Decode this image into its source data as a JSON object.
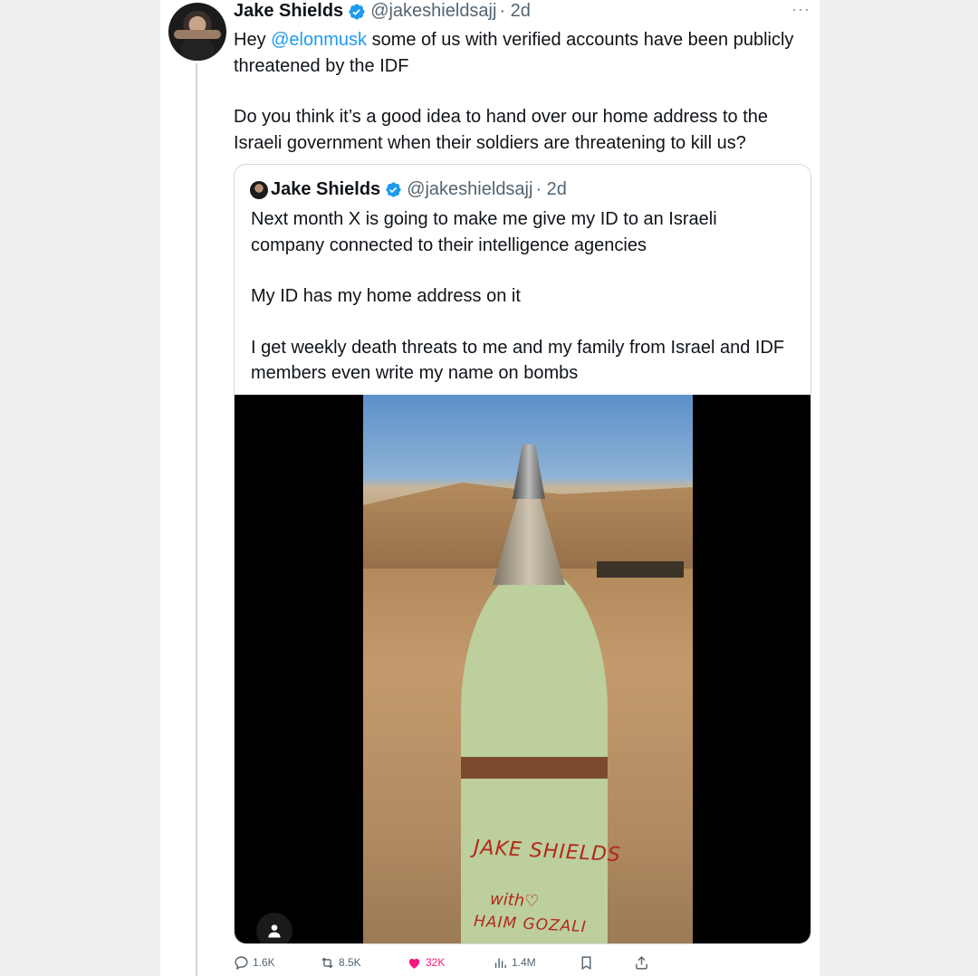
{
  "tweet": {
    "author_name": "Jake Shields",
    "handle": "@jakeshieldsajj",
    "time": "· 2d",
    "more": "···",
    "text_before_mention": "Hey ",
    "mention": "@elonmusk",
    "text_after_mention": " some of us with verified accounts have been publicly threatened by the IDF",
    "paragraph2": "Do you think it’s a good idea to hand over our home address to the Israeli government when their soldiers are threatening to kill us?"
  },
  "quote": {
    "author_name": "Jake Shields",
    "handle": "@jakeshieldsajj",
    "time": "· 2d",
    "paragraph1": "Next month X is going to make me give my ID to an Israeli company connected to their intelligence agencies",
    "paragraph2": "My ID has my home address on it",
    "paragraph3": "I get weekly death threats to me and my family from Israel and IDF members even write my name on bombs",
    "photo_writing": {
      "line1": "JAKE SHIELDS",
      "line2": "with♡",
      "line3": "HAIM GOZALI"
    }
  },
  "actions": {
    "replies": "1.6K",
    "reposts": "8.5K",
    "likes": "32K",
    "views": "1.4M"
  },
  "icons": {
    "reply": "reply-icon",
    "repost": "repost-icon",
    "like": "heart-icon",
    "views": "views-icon",
    "bookmark": "bookmark-icon",
    "share": "share-icon",
    "verified": "verified-badge-icon",
    "media_user": "person-icon"
  },
  "colors": {
    "link": "#1d9bf0",
    "like": "#f91880",
    "secondary_text": "#536471"
  }
}
